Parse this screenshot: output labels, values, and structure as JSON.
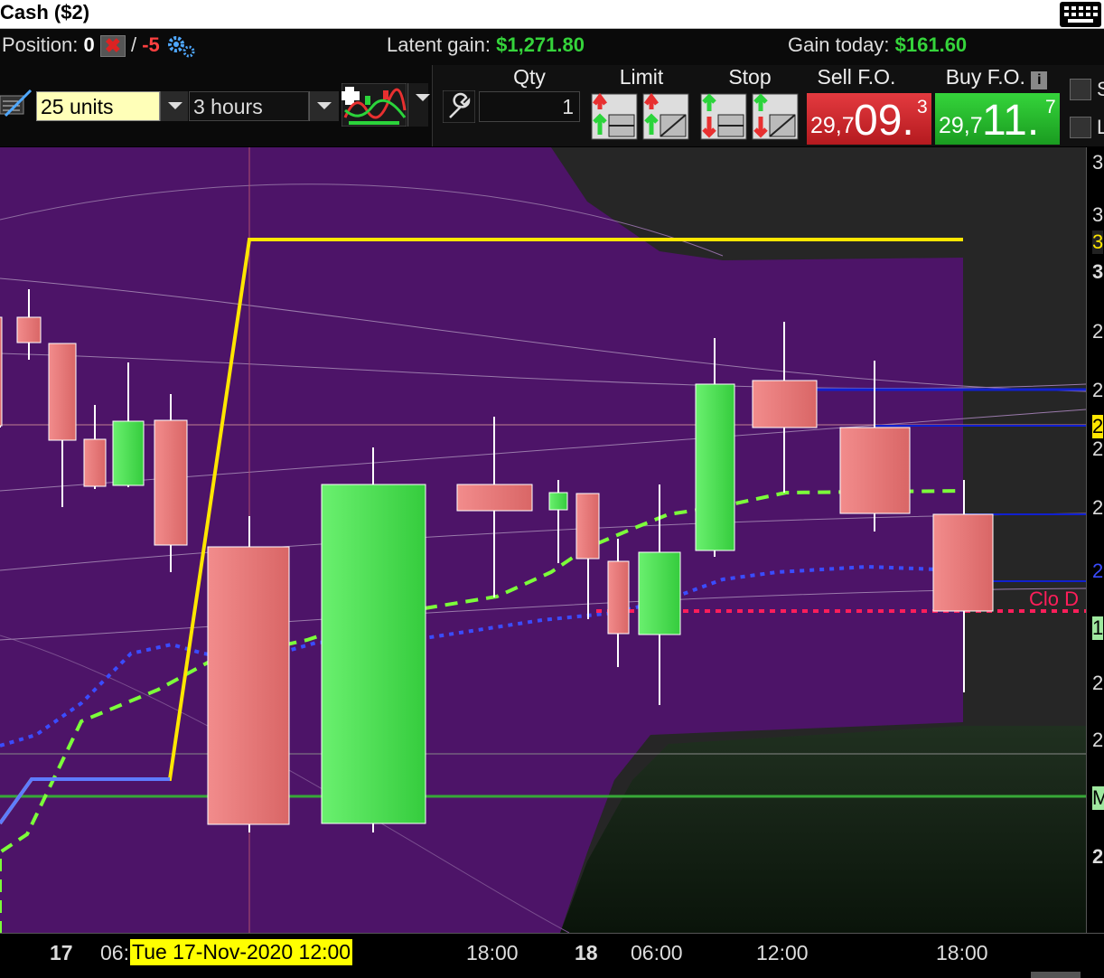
{
  "window": {
    "title": "Cash ($2)"
  },
  "status": {
    "position_label": "Position: ",
    "position_value": "0",
    "slash": " / ",
    "position_alt": "-5",
    "latent_label": "Latent gain: ",
    "latent_value": "$1,271.80",
    "gain_label": "Gain today: ",
    "gain_value": "$161.60"
  },
  "toolbar": {
    "units_value": "25 units",
    "period_value": "3 hours",
    "qty_header": "Qty",
    "qty_value": "1",
    "limit_header": "Limit",
    "stop_header": "Stop",
    "sell_header": "Sell F.O.",
    "buy_header": "Buy F.O.",
    "sell_prefix": "29,7",
    "sell_big": "09.",
    "sell_sup": "3",
    "buy_prefix": "29,7",
    "buy_big": "11.",
    "buy_sup": "7",
    "info_symbol": "i",
    "right_label_1": "S",
    "right_label_2": "L"
  },
  "colors": {
    "bull": "#4fe05a",
    "bear": "#f07b7b",
    "band": "#4a1466",
    "ma_yellow": "#ffe600",
    "ma_green": "#7cff3a",
    "ma_blue": "#3a4cff",
    "ma_red": "#ff1e5a",
    "level_green": "#2fa52f",
    "level_blue": "#1020d0",
    "sell_bg": "#d9262b",
    "buy_bg": "#22b52a"
  },
  "axis": {
    "y_labels": [
      "3",
      "3",
      "3",
      "3",
      "2",
      "2",
      "2",
      "2",
      "2",
      "2",
      "1",
      "2",
      "2",
      "M",
      "2"
    ],
    "x_labels": [
      "17",
      "06:",
      "18:00",
      "18",
      "06:00",
      "12:00",
      "18:00"
    ],
    "cursor_label": "Tue 17-Nov-2020 12:00",
    "close_label": "Clo D"
  }
}
